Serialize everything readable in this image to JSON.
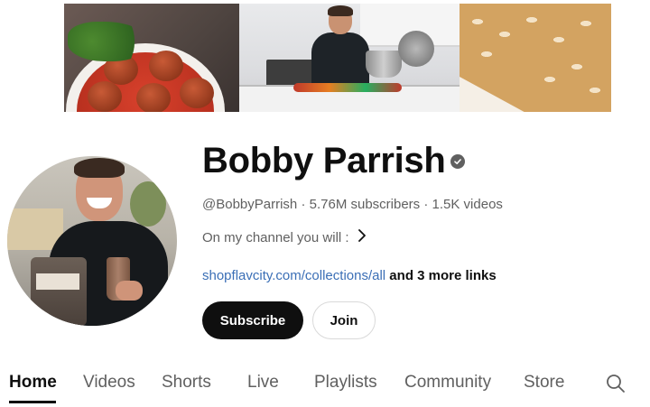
{
  "channel": {
    "name": "Bobby Parrish",
    "handle": "@BobbyParrish",
    "separator": " · ",
    "subscribers": "5.76M subscribers",
    "videos": "1.5K videos",
    "description": "On my channel you will :",
    "link_url": "shopflavcity.com/collections/all",
    "more_links": " and 3 more links"
  },
  "buttons": {
    "subscribe": "Subscribe",
    "join": "Join"
  },
  "tabs": [
    {
      "label": "Home",
      "active": true
    },
    {
      "label": "Videos"
    },
    {
      "label": "Shorts"
    },
    {
      "label": "Live"
    },
    {
      "label": "Playlists"
    },
    {
      "label": "Community"
    },
    {
      "label": "Store"
    }
  ],
  "icons": {
    "verified": "verified-check-icon",
    "chevron": "chevron-right-icon",
    "search": "search-icon"
  },
  "colors": {
    "text_primary": "#0f0f0f",
    "text_secondary": "#606060",
    "link": "#3b6fb6",
    "subscribe_bg": "#0f0f0f"
  }
}
